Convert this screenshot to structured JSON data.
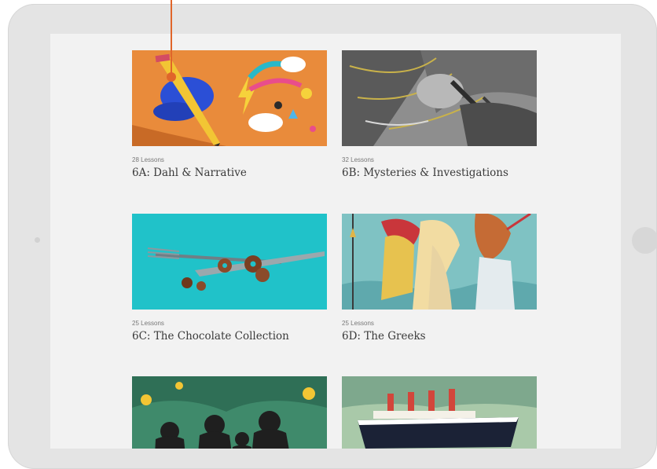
{
  "courses": [
    {
      "lessons": "28 Lessons",
      "title": "6A: Dahl & Narrative",
      "image_icon": "illustrated-hand-pencil-icon"
    },
    {
      "lessons": "32 Lessons",
      "title": "6B: Mysteries & Investigations",
      "image_icon": "engraved-detective-icon"
    },
    {
      "lessons": "25 Lessons",
      "title": "6C: The Chocolate Collection",
      "image_icon": "fork-knife-chocolate-icon"
    },
    {
      "lessons": "25 Lessons",
      "title": "6D: The Greeks",
      "image_icon": "greek-warriors-icon"
    },
    {
      "image_icon": "forest-silhouettes-icon"
    },
    {
      "image_icon": "ocean-liner-icon"
    }
  ],
  "colors": {
    "accent_pointer": "#e0652a",
    "tablet_frame": "#e4e4e4",
    "screen_bg": "#f2f2f2"
  }
}
